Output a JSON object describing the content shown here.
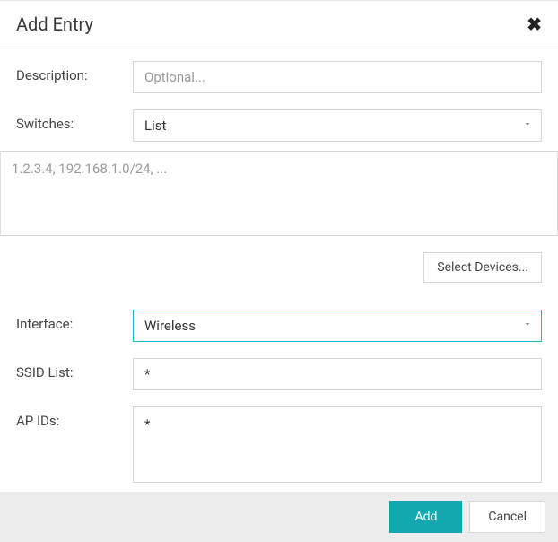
{
  "dialog": {
    "title": "Add Entry"
  },
  "form": {
    "description": {
      "label": "Description:",
      "placeholder": "Optional..."
    },
    "switches": {
      "label": "Switches:",
      "value": "List"
    },
    "iplist": {
      "placeholder": "1.2.3.4, 192.168.1.0/24, ..."
    },
    "select_devices": "Select Devices...",
    "interface": {
      "label": "Interface:",
      "value": "Wireless"
    },
    "ssid_list": {
      "label": "SSID List:",
      "value": "*"
    },
    "ap_ids": {
      "label": "AP IDs:",
      "value": "*"
    }
  },
  "buttons": {
    "add": "Add",
    "cancel": "Cancel"
  }
}
